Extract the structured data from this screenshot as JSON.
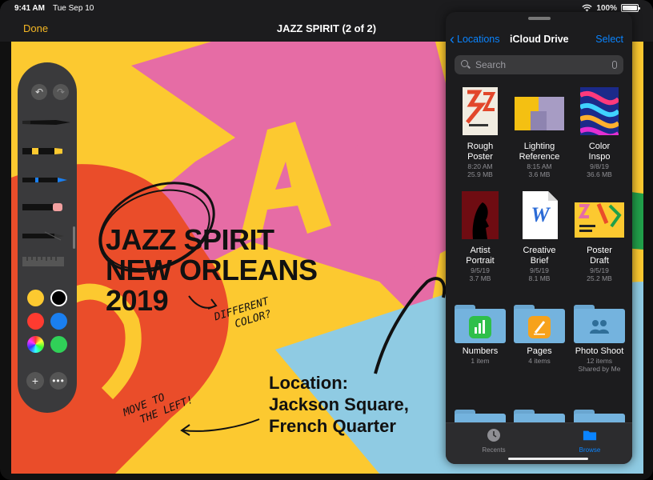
{
  "status": {
    "time": "9:41 AM",
    "date": "Tue Sep 10",
    "battery": "100%"
  },
  "navbar": {
    "done": "Done",
    "title": "JAZZ SPIRIT (2 of 2)"
  },
  "poster": {
    "headline": [
      "JAZZ SPIRIT",
      "NEW ORLEANS",
      "2019"
    ],
    "location": [
      "Location:",
      "Jackson Square,",
      "French Quarter"
    ],
    "annotation1": [
      "DIFFERENT",
      "COLOR?"
    ],
    "annotation2": [
      "MOVE TO",
      "THE LEFT!"
    ],
    "colors": {
      "yellow": "#fcc930",
      "pink": "#e66ca5",
      "red": "#ea4d2a",
      "lightblue": "#8fcbe3",
      "green": "#21a04a"
    }
  },
  "palette": {
    "undo": "↶",
    "redo": "↷",
    "add": "+",
    "more": "•••",
    "colors": [
      "yellow",
      "black",
      "red",
      "blue",
      "color-wheel",
      "green"
    ]
  },
  "files": {
    "back": "Locations",
    "title": "iCloud Drive",
    "select": "Select",
    "search_placeholder": "Search",
    "items": [
      {
        "name": [
          "Rough",
          "Poster"
        ],
        "meta": [
          "8:20 AM",
          "25.9 MB"
        ]
      },
      {
        "name": [
          "Lighting",
          "Reference"
        ],
        "meta": [
          "8:15 AM",
          "3.6 MB"
        ]
      },
      {
        "name": [
          "Color",
          "Inspo"
        ],
        "meta": [
          "9/8/19",
          "36.6 MB"
        ]
      },
      {
        "name": [
          "Artist",
          "Portrait"
        ],
        "meta": [
          "9/5/19",
          "3.7 MB"
        ]
      },
      {
        "name": [
          "Creative",
          "Brief"
        ],
        "meta": [
          "9/5/19",
          "8.1 MB"
        ]
      },
      {
        "name": [
          "Poster",
          "Draft"
        ],
        "meta": [
          "9/5/19",
          "25.2 MB"
        ]
      }
    ],
    "folders": [
      {
        "name": "Numbers",
        "meta": [
          "1 item"
        ]
      },
      {
        "name": "Pages",
        "meta": [
          "4 items"
        ]
      },
      {
        "name": "Photo Shoot",
        "meta": [
          "12 items",
          "Shared by Me"
        ]
      }
    ],
    "tabs": {
      "recents": "Recents",
      "browse": "Browse"
    }
  }
}
